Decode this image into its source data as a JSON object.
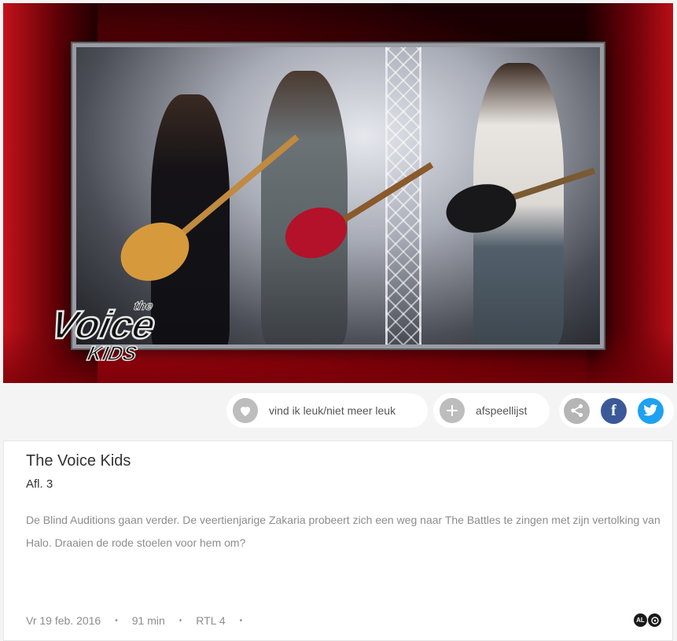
{
  "video": {
    "logo_line1": "the",
    "logo_line2": "Voice",
    "logo_line3": "KIDS"
  },
  "actions": {
    "like_label": "vind ik leuk/niet meer leuk",
    "playlist_label": "afspeellijst",
    "facebook_glyph": "f"
  },
  "program": {
    "title": "The Voice Kids",
    "episode": "Afl. 3",
    "description": "De Blind Auditions gaan verder. De veertienjarige Zakaria probeert zich een weg naar The Battles te zingen met zijn vertolking van Halo. Draaien de rode stoelen voor hem om?",
    "date": "Vr 19 feb. 2016",
    "duration": "91 min",
    "channel": "RTL 4",
    "separator": "•",
    "rating_al": "AL"
  },
  "colors": {
    "facebook": "#3b5998",
    "twitter": "#1da1f2",
    "icon_grey": "#bdbdbd"
  },
  "icons": [
    "heart-icon",
    "plus-icon",
    "share-icon",
    "facebook-icon",
    "twitter-icon"
  ]
}
